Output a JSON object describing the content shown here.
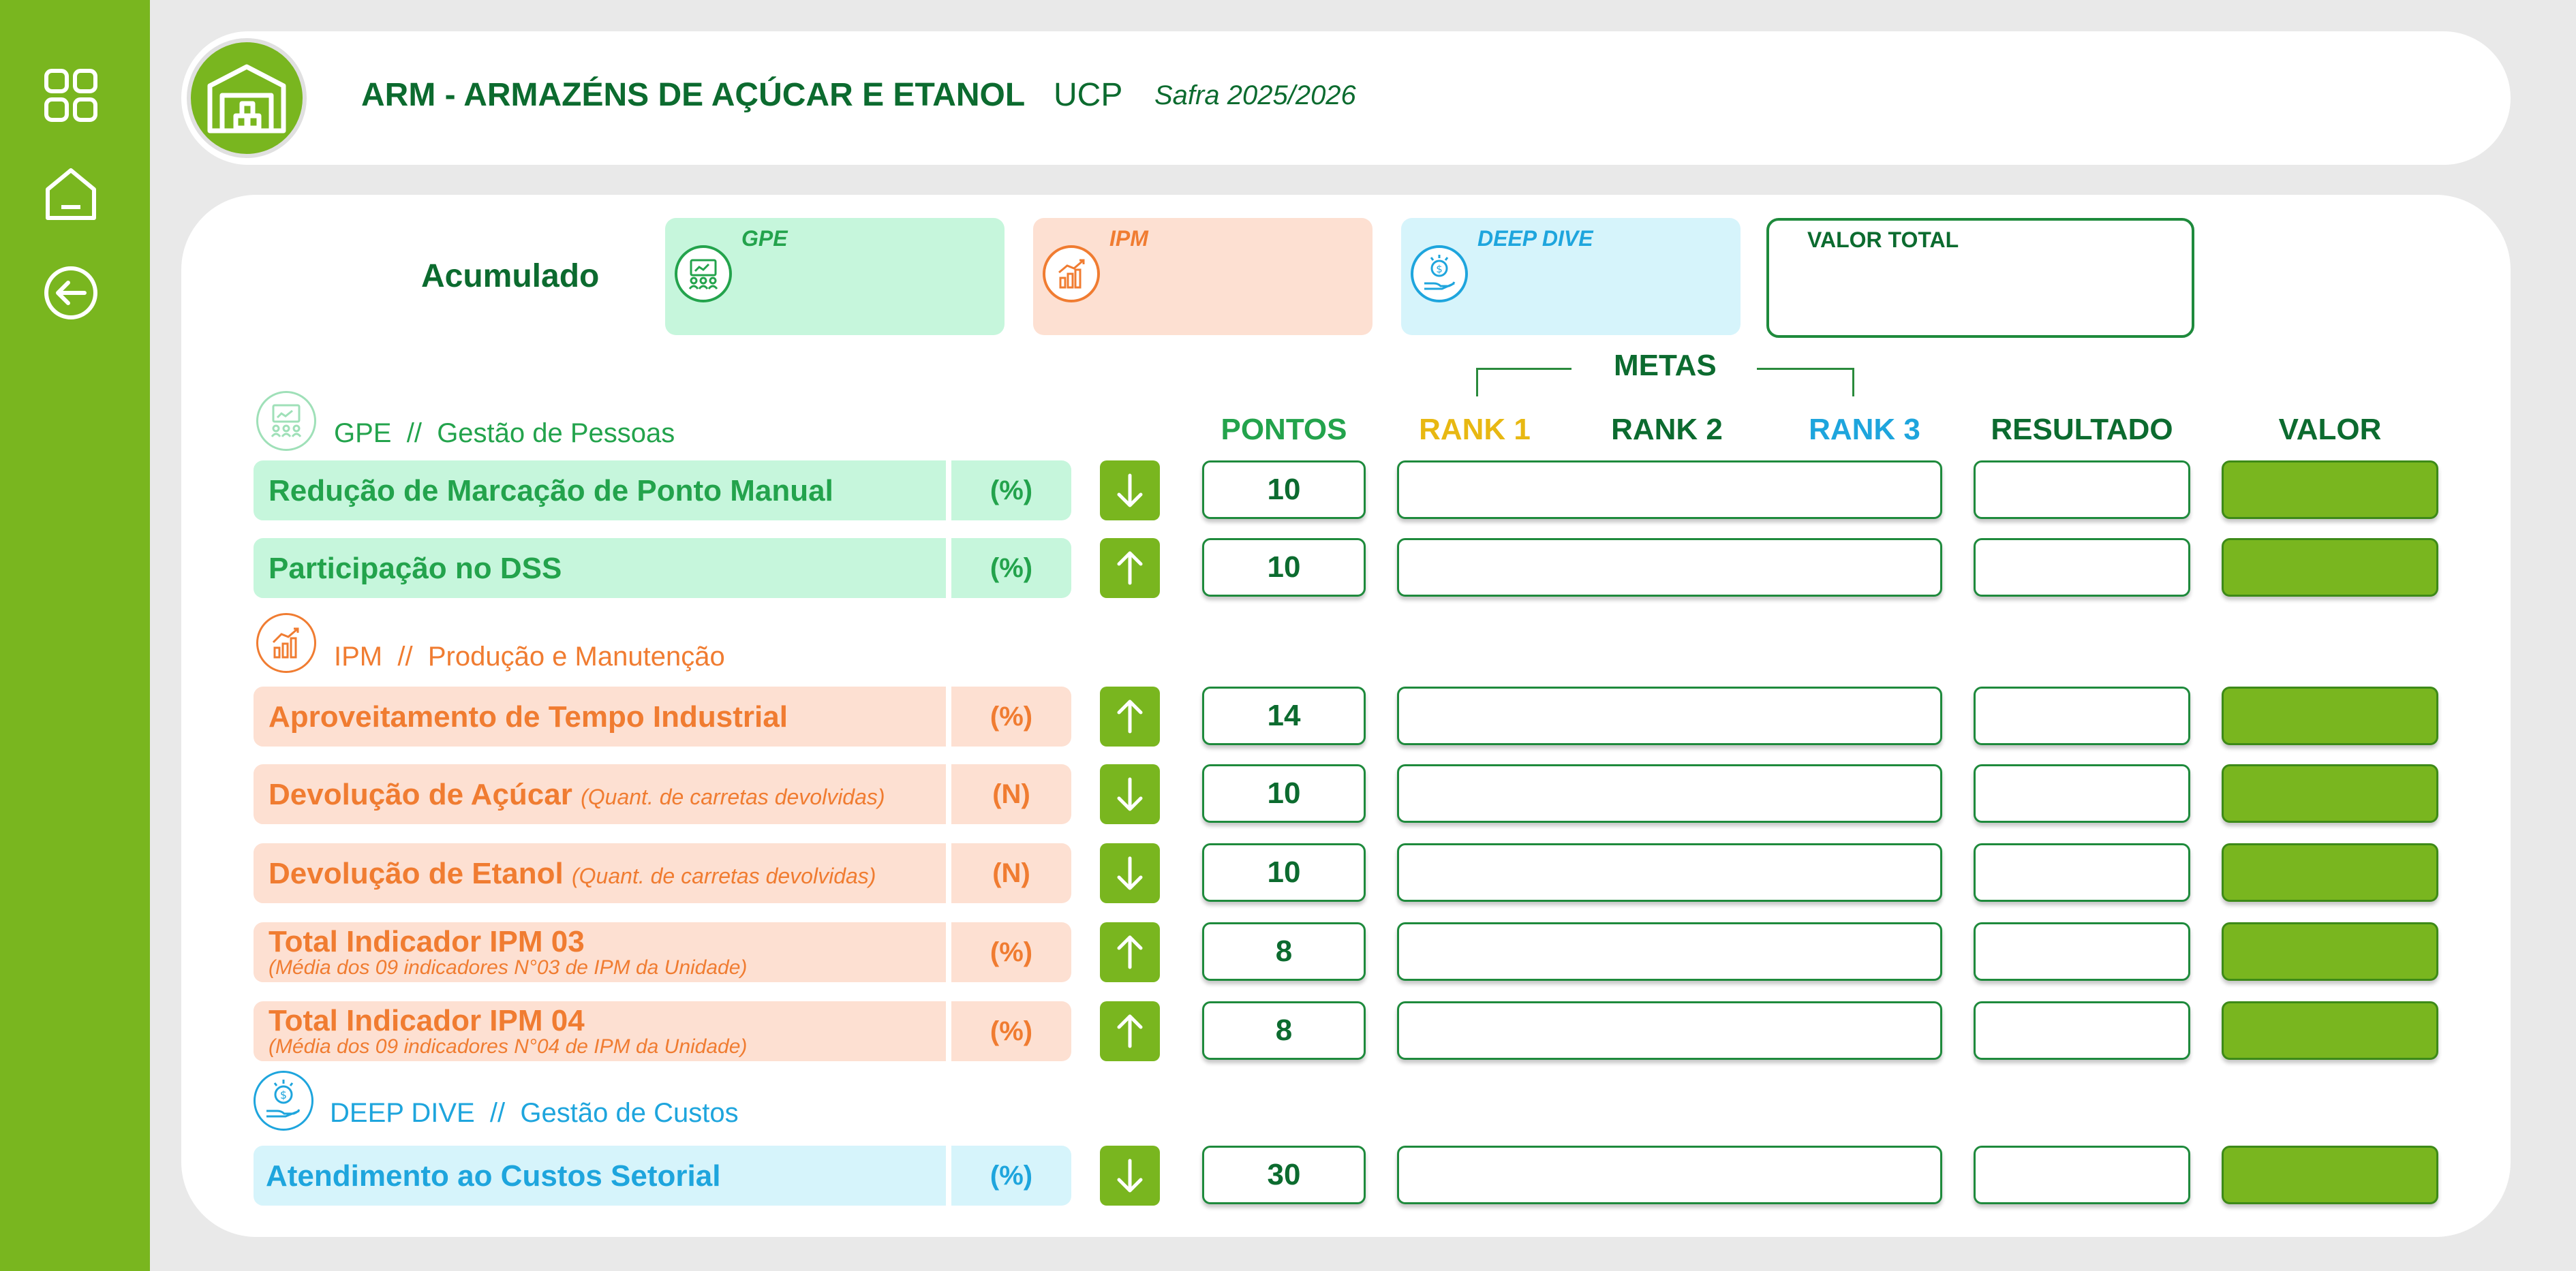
{
  "header": {
    "title": "ARM - ARMAZÉNS DE AÇÚCAR E ETANOL",
    "unit": "UCP",
    "safra": "Safra 2025/2026",
    "logo_icon": "warehouse-icon"
  },
  "sidebar": {
    "items": [
      {
        "icon": "grid-icon"
      },
      {
        "icon": "home-icon"
      },
      {
        "icon": "back-arrow-icon"
      }
    ]
  },
  "summary": {
    "acumulado_label": "Acumulado",
    "cards": [
      {
        "label": "GPE",
        "icon": "people-presentation-icon",
        "color": "#23a34c"
      },
      {
        "label": "IPM",
        "icon": "growth-chart-icon",
        "color": "#f07c31"
      },
      {
        "label": "DEEP DIVE",
        "icon": "money-hand-icon",
        "color": "#1ea5dd"
      }
    ],
    "valor_total_label": "VALOR TOTAL"
  },
  "columns": {
    "metas": "METAS",
    "pontos": "PONTOS",
    "rank1": "RANK 1",
    "rank2": "RANK 2",
    "rank3": "RANK 3",
    "resultado": "RESULTADO",
    "valor": "VALOR"
  },
  "sections": {
    "gpe": {
      "code": "GPE",
      "sep": "//",
      "name": "Gestão de Pessoas"
    },
    "ipm": {
      "code": "IPM",
      "sep": "//",
      "name": "Produção e Manutenção"
    },
    "deep": {
      "code": "DEEP DIVE",
      "sep": "//",
      "name": "Gestão de Custos"
    }
  },
  "rows": [
    {
      "name": "Redução de Marcação de Ponto Manual",
      "unit": "(%)",
      "arrow": "down",
      "pontos": "10"
    },
    {
      "name": "Participação no DSS",
      "unit": "(%)",
      "arrow": "up",
      "pontos": "10"
    },
    {
      "name": "Aproveitamento de Tempo Industrial",
      "unit": "(%)",
      "arrow": "up",
      "pontos": "14"
    },
    {
      "name": "Devolução de Açúcar",
      "sub": "(Quant. de carretas devolvidas)",
      "unit": "(N)",
      "arrow": "down",
      "pontos": "10"
    },
    {
      "name": "Devolução de Etanol",
      "sub": "(Quant. de carretas devolvidas)",
      "unit": "(N)",
      "arrow": "down",
      "pontos": "10"
    },
    {
      "name": "Total Indicador IPM 03",
      "sub": "(Média dos 09 indicadores N°03 de IPM da Unidade)",
      "unit": "(%)",
      "arrow": "up",
      "pontos": "8"
    },
    {
      "name": "Total Indicador IPM 04",
      "sub": "(Média dos 09 indicadores N°04 de IPM da Unidade)",
      "unit": "(%)",
      "arrow": "up",
      "pontos": "8"
    },
    {
      "name": "Atendimento ao Custos Setorial",
      "unit": "(%)",
      "arrow": "down",
      "pontos": "30"
    }
  ],
  "colors": {
    "brand_green": "#79b61f",
    "dark_green": "#0c6b2f",
    "gpe_green": "#23a34c",
    "ipm_orange": "#f07c31",
    "deep_blue": "#1ea5dd",
    "rank1_yellow": "#e8b812"
  }
}
